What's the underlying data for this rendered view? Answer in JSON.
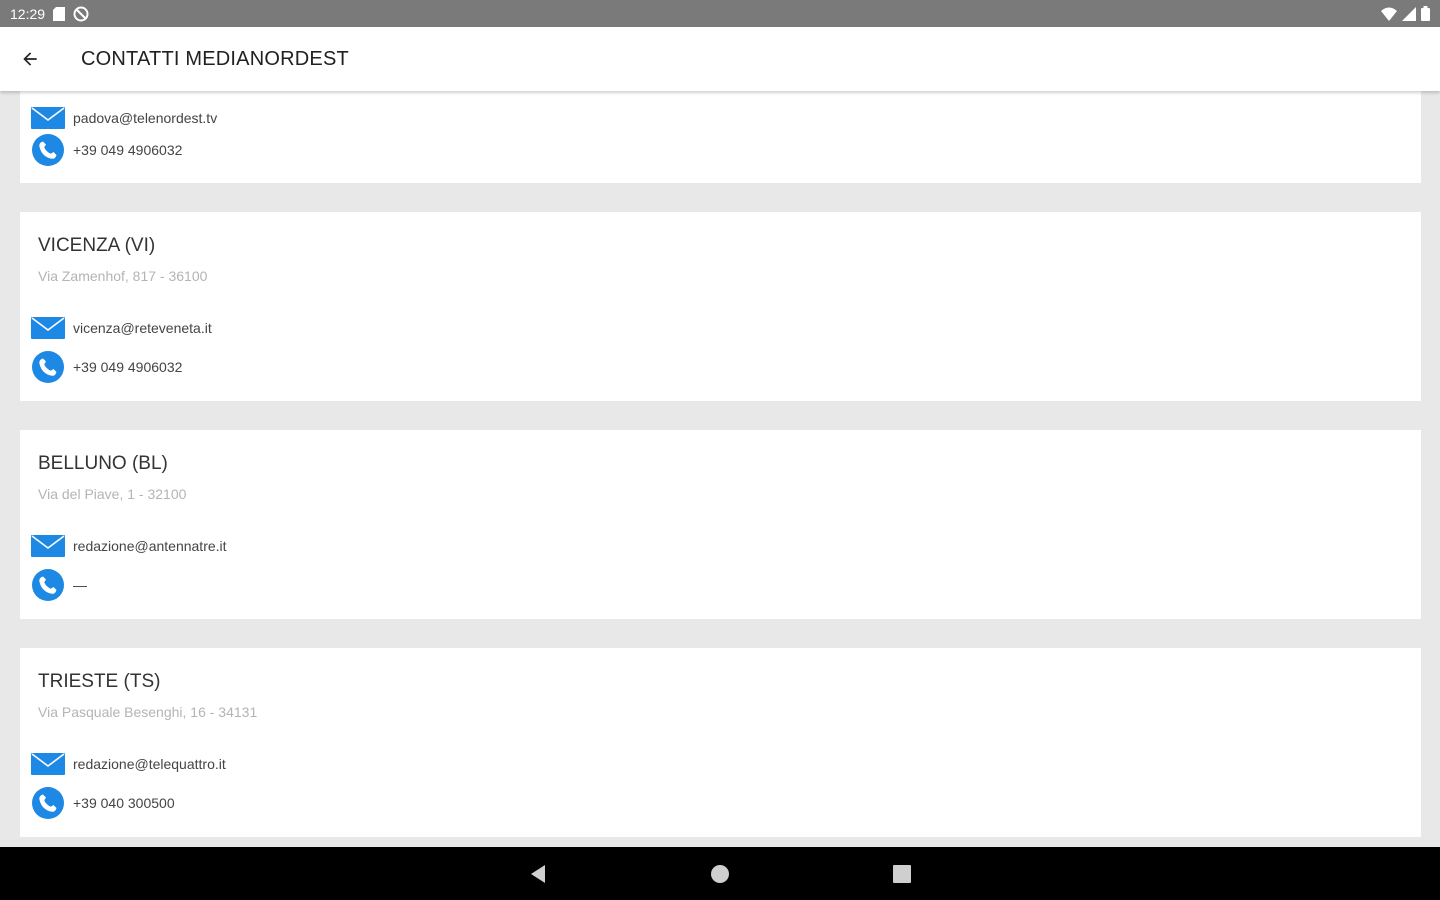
{
  "status_bar": {
    "time": "12:29",
    "icons": [
      "sd-card-icon",
      "blocked-icon",
      "wifi-icon",
      "signal-icon",
      "battery-icon"
    ]
  },
  "toolbar": {
    "title": "CONTATTI MEDIANORDEST",
    "back_icon": "arrow-back-icon"
  },
  "colors": {
    "accent": "#1e88e5",
    "statusbar": "#7a7a7a",
    "background": "#e8e8e8"
  },
  "contacts": [
    {
      "name": "",
      "address": "",
      "email": "padova@telenordest.tv",
      "phone": "+39 049 4906032"
    },
    {
      "name": "VICENZA (VI)",
      "address": "Via Zamenhof, 817 - 36100",
      "email": "vicenza@reteveneta.it",
      "phone": "+39 049 4906032"
    },
    {
      "name": "BELLUNO (BL)",
      "address": "Via del Piave, 1 - 32100",
      "email": "redazione@antennatre.it",
      "phone": "—"
    },
    {
      "name": "TRIESTE (TS)",
      "address": "Via Pasquale Besenghi, 16 - 34131",
      "email": "redazione@telequattro.it",
      "phone": "+39 040 300500"
    }
  ],
  "nav_bar": {
    "buttons": [
      "back-triangle-icon",
      "home-circle-icon",
      "recents-square-icon"
    ]
  }
}
